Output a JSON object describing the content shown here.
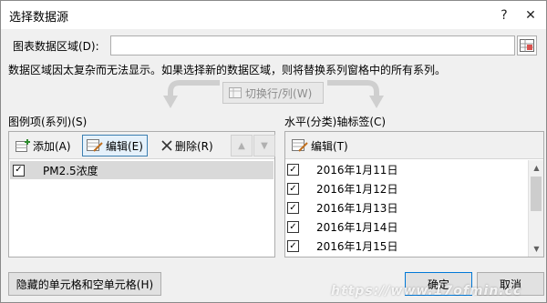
{
  "window": {
    "title": "选择数据源",
    "help_glyph": "?",
    "close_glyph": "✕"
  },
  "source": {
    "label": "图表数据区域(D):",
    "value": ""
  },
  "notice": "数据区域因太复杂而无法显示。如果选择新的数据区域，则将替换系列窗格中的所有系列。",
  "switch_button": "切换行/列(W)",
  "legend": {
    "heading": "图例项(系列)(S)",
    "add": "添加(A)",
    "edit": "编辑(E)",
    "delete": "删除(R)",
    "up_glyph": "▲",
    "down_glyph": "▼",
    "series": [
      {
        "name": "PM2.5浓度",
        "checked": true
      }
    ]
  },
  "axis": {
    "heading": "水平(分类)轴标签(C)",
    "edit": "编辑(T)",
    "items": [
      "2016年1月11日",
      "2016年1月12日",
      "2016年1月13日",
      "2016年1月14日",
      "2016年1月15日"
    ]
  },
  "buttons": {
    "hidden_cells": "隐藏的单元格和空单元格(H)",
    "ok": "确定",
    "cancel": "取消"
  },
  "watermark": "https://www.17ofmin.cc",
  "colors": {
    "accent": "#0078d7",
    "selected_row": "#d9d9d9",
    "background": "#f0f0f0"
  }
}
